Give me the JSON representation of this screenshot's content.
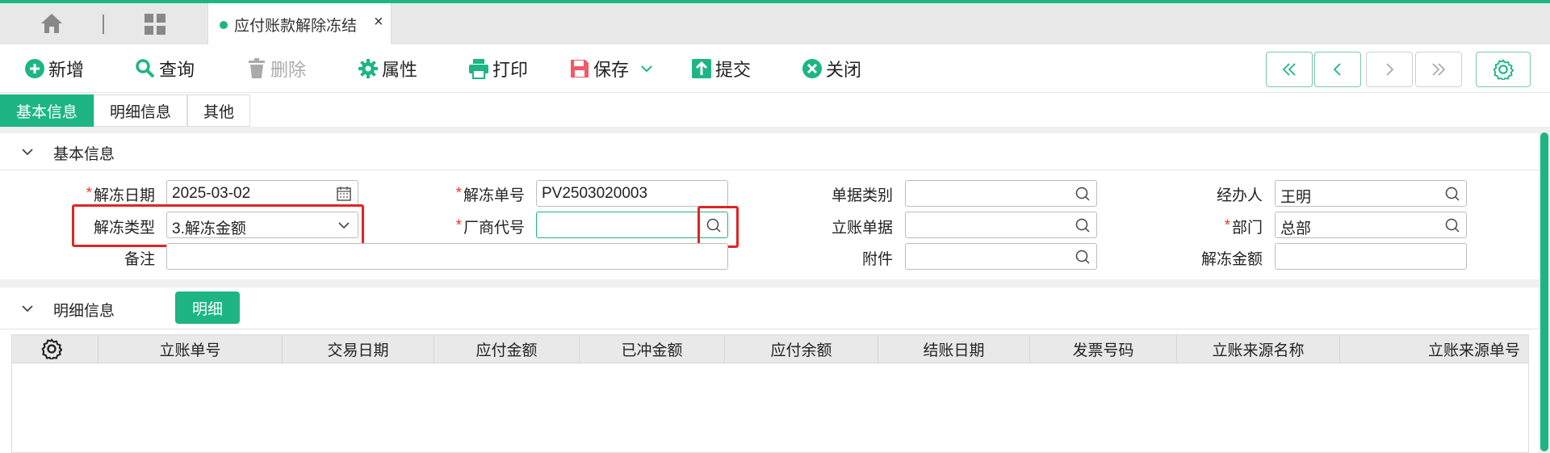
{
  "tabbar": {
    "active_tab": "应付账款解除冻结",
    "close_glyph": "×"
  },
  "toolbar": {
    "add": "新增",
    "query": "查询",
    "delete": "删除",
    "properties": "属性",
    "print": "打印",
    "save": "保存",
    "submit": "提交",
    "close": "关闭"
  },
  "subtabs": [
    "基本信息",
    "明细信息",
    "其他"
  ],
  "basic_section": {
    "title": "基本信息",
    "fields": {
      "unfreeze_date": {
        "label": "解冻日期",
        "value": "2025-03-02",
        "required": true
      },
      "unfreeze_no": {
        "label": "解冻单号",
        "value": "PV2503020003",
        "required": true
      },
      "doc_category": {
        "label": "单据类别",
        "value": ""
      },
      "handler": {
        "label": "经办人",
        "value": "王明"
      },
      "unfreeze_type": {
        "label": "解冻类型",
        "value": "3.解冻金额"
      },
      "vendor_code": {
        "label": "厂商代号",
        "value": "",
        "required": true
      },
      "account_doc": {
        "label": "立账单据",
        "value": ""
      },
      "department": {
        "label": "部门",
        "value": "总部",
        "required": true
      },
      "remark": {
        "label": "备注",
        "value": ""
      },
      "attachment": {
        "label": "附件",
        "value": ""
      },
      "unfreeze_amount": {
        "label": "解冻金额",
        "value": ""
      }
    }
  },
  "detail_section": {
    "title": "明细信息",
    "detail_button": "明细",
    "columns": [
      "立账单号",
      "交易日期",
      "应付金额",
      "已冲金额",
      "应付余额",
      "结账日期",
      "发票号码",
      "立账来源名称",
      "立账来源单号"
    ],
    "rows": []
  },
  "colors": {
    "accent": "#1eb585",
    "highlight": "#e02424",
    "required": "#e53935"
  }
}
